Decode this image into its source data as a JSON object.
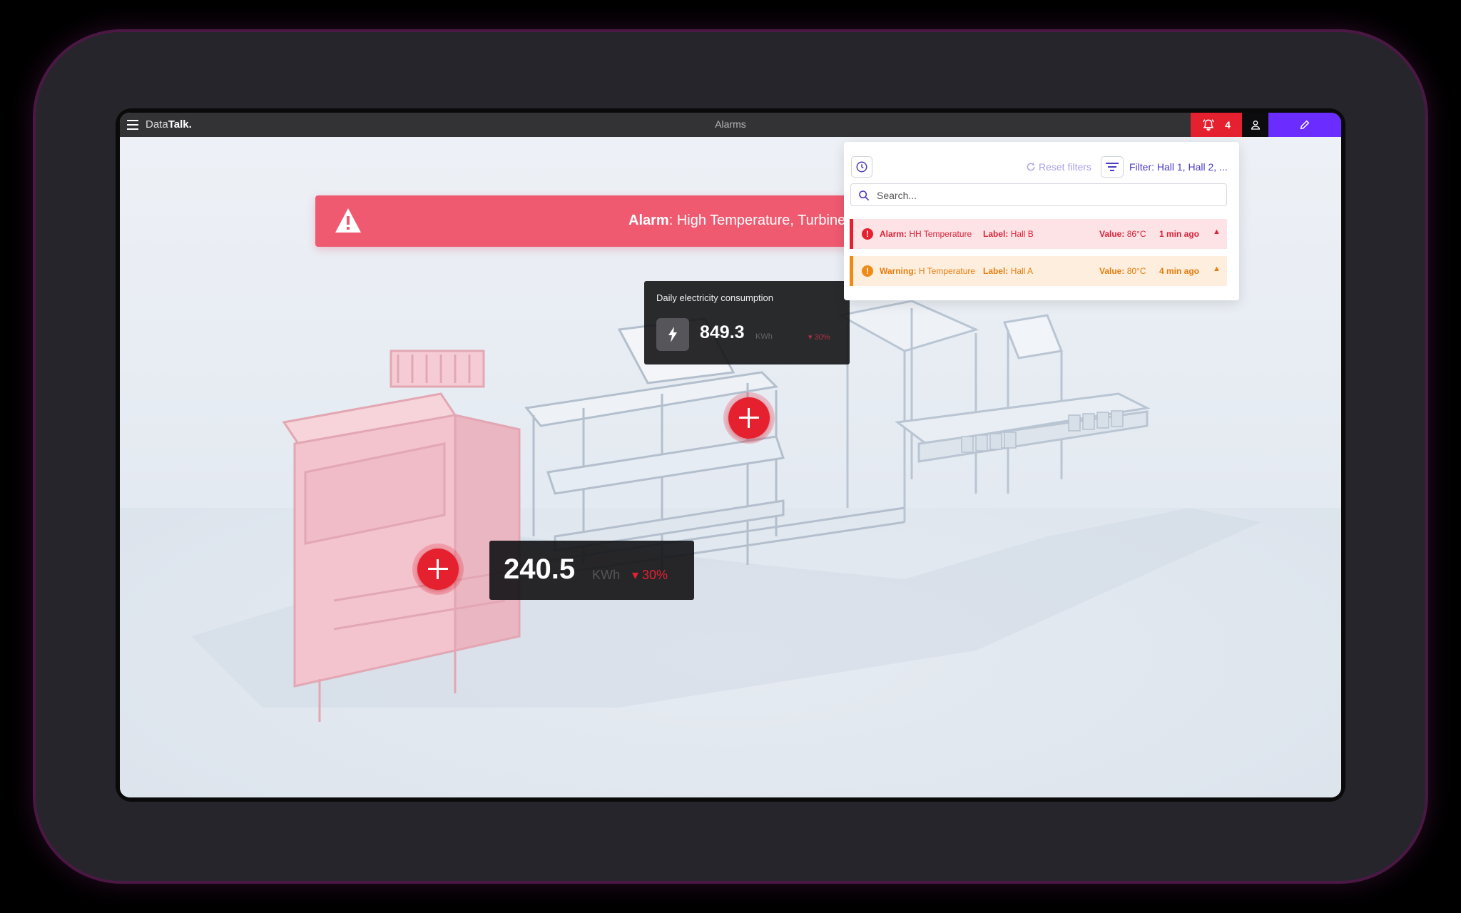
{
  "topbar": {
    "brand_light": "Data",
    "brand_bold": "Talk.",
    "title": "Alarms",
    "alarm_count": "4",
    "icons": [
      "menu-icon",
      "bell-alert-icon",
      "user-icon",
      "pencil-icon"
    ]
  },
  "banner": {
    "label": "Alarm",
    "message": ": High Temperature, Turbine C"
  },
  "panel": {
    "reset_label": "Reset filters",
    "filter_label": "Filter: Hall 1, Hall 2, ...",
    "search_placeholder": "Search...",
    "rows": [
      {
        "kind": "alarm",
        "type_label": "Alarm:",
        "type_value": "HH Temperature",
        "label_key": "Label:",
        "label_value": "Hall B",
        "value_key": "Value:",
        "value": "86°C",
        "time": "1 min ago"
      },
      {
        "kind": "warning",
        "type_label": "Warning:",
        "type_value": "H Temperature",
        "label_key": "Label:",
        "label_value": "Hall A",
        "value_key": "Value:",
        "value": "80°C",
        "time": "4 min ago"
      }
    ]
  },
  "card": {
    "title": "Daily electricity consumption",
    "value": "849.3",
    "unit": "KWh",
    "delta": "▾ 30%"
  },
  "badge": {
    "value": "240.5",
    "unit": "KWh",
    "delta": "▾ 30%"
  },
  "colors": {
    "alarm": "#e5202f",
    "warning": "#f08a16",
    "accent": "#6a2cff",
    "banner": "#ef5a70"
  }
}
